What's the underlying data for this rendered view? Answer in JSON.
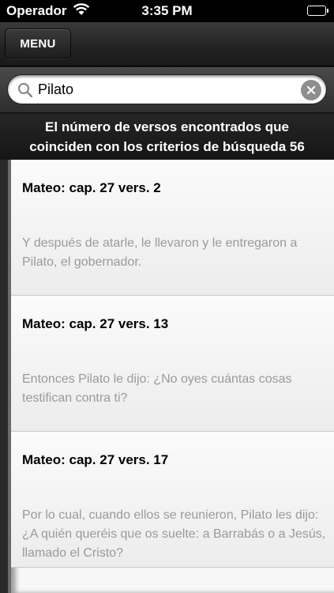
{
  "status_bar": {
    "carrier": "Operador",
    "time": "3:35 PM",
    "wifi_icon": "wifi-icon",
    "battery_icon": "battery-icon"
  },
  "toolbar": {
    "menu_label": "MENU"
  },
  "search": {
    "value": "Pilato",
    "icon": "search-icon",
    "clear_icon": "clear-icon"
  },
  "results": {
    "summary_line1": "El número de versos encontrados que",
    "summary_line2": "coinciden con los criterios de búsqueda 56",
    "items": [
      {
        "reference": "Mateo: cap. 27 vers. 2",
        "text": "Y después de atarle, le llevaron y le entregaron a Pilato, el gobernador."
      },
      {
        "reference": "Mateo: cap. 27 vers. 13",
        "text": "Entonces Pilato le dijo: ¿No oyes cuántas cosas testifican contra ti?"
      },
      {
        "reference": "Mateo: cap. 27 vers. 17",
        "text": "Por lo cual, cuando ellos se reunieron, Pilato les dijo: ¿A quién queréis que os suelte: a Barrabás o a Jesús, llamado el Cristo?"
      }
    ]
  },
  "colors": {
    "bar_background": "#222222",
    "list_background": "#f7f7f7",
    "verse_text": "#9a9a9a"
  }
}
